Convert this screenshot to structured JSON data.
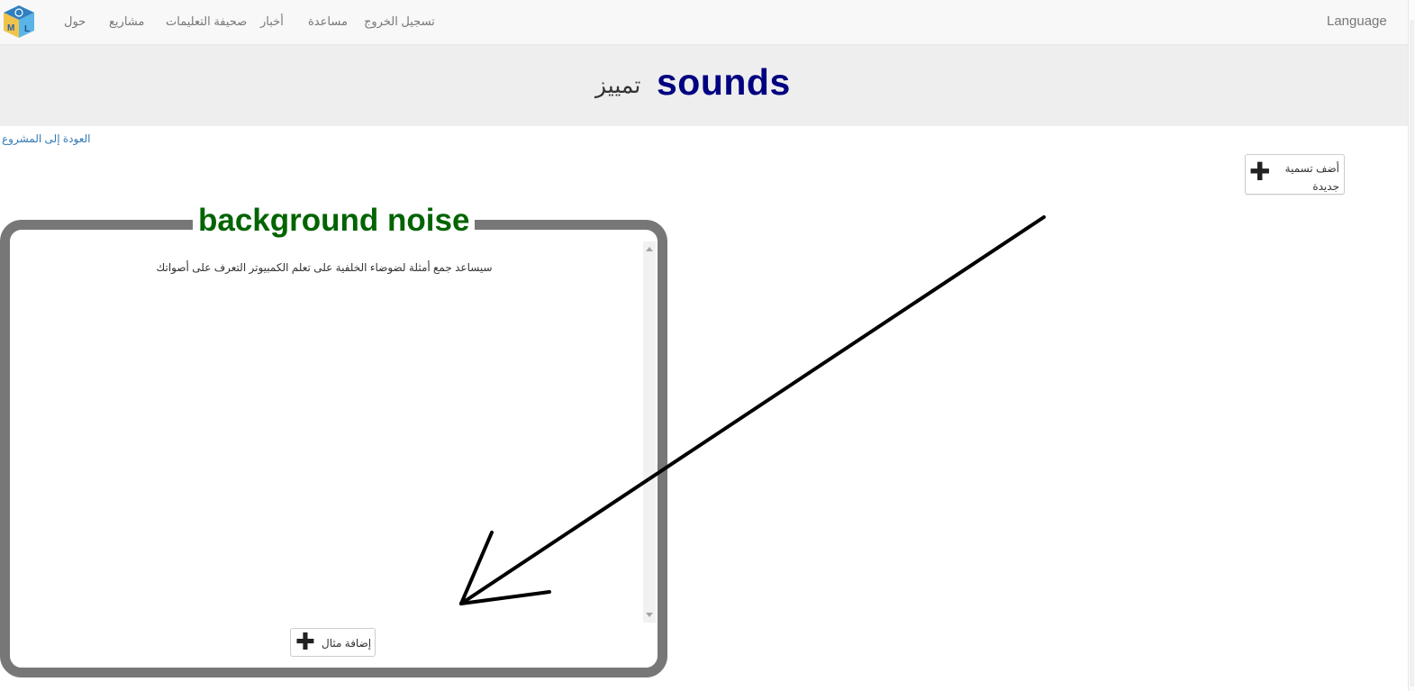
{
  "navbar": {
    "items": [
      "حول",
      "مشاريع",
      "صحيفة التعليمات",
      "أخبار",
      "مساعدة",
      "تسجيل الخروج"
    ],
    "language_label": "Language"
  },
  "header": {
    "project_name": "sounds",
    "project_type": "تمييز"
  },
  "back_link": "العودة إلى المشروع",
  "add_label_button": "أضف تسمية جديدة",
  "label": {
    "name": "background noise",
    "description": "سيساعد جمع أمثلة لضوضاء الخلفية على تعلم الكمبيوتر التعرف على أصواتك",
    "add_example_button": "إضافة مثال"
  },
  "colors": {
    "project_name": "#000080",
    "label_name": "#006400",
    "card_border": "#777777",
    "link": "#337ab7"
  },
  "icons": [
    "ml-logo-icon",
    "plus-icon",
    "annotation-arrow"
  ]
}
